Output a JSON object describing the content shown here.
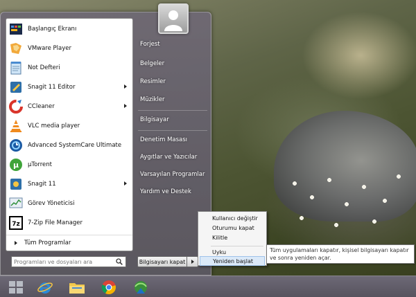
{
  "start_menu": {
    "programs": [
      {
        "label": "Başlangıç Ekranı",
        "icon": "start-screen-icon",
        "has_submenu": false
      },
      {
        "label": "VMware Player",
        "icon": "vmware-icon",
        "has_submenu": false
      },
      {
        "label": "Not Defteri",
        "icon": "notepad-icon",
        "has_submenu": false
      },
      {
        "label": "Snagit 11 Editor",
        "icon": "snagit-editor-icon",
        "has_submenu": true
      },
      {
        "label": "CCleaner",
        "icon": "ccleaner-icon",
        "has_submenu": true
      },
      {
        "label": "VLC media player",
        "icon": "vlc-icon",
        "has_submenu": false
      },
      {
        "label": "Advanced SystemCare Ultimate",
        "icon": "systemcare-icon",
        "has_submenu": false
      },
      {
        "label": "µTorrent",
        "icon": "utorrent-icon",
        "has_submenu": false
      },
      {
        "label": "Snagit 11",
        "icon": "snagit-icon",
        "has_submenu": true
      },
      {
        "label": "Görev Yöneticisi",
        "icon": "task-manager-icon",
        "has_submenu": false
      },
      {
        "label": "7-Zip File Manager",
        "icon": "7zip-icon",
        "has_submenu": false
      }
    ],
    "all_programs_label": "Tüm Programlar",
    "search_placeholder": "Programları ve dosyaları ara",
    "right_items": [
      "Forjest",
      "Belgeler",
      "Resimler",
      "Müzikler",
      "Bilgisayar",
      "Denetim Masası",
      "Aygıtlar ve Yazıcılar",
      "Varsayılan Programlar",
      "Yardım ve Destek"
    ],
    "shutdown_label": "Bilgisayarı kapat"
  },
  "shutdown_submenu": {
    "items": [
      "Kullanıcı değiştir",
      "Oturumu kapat",
      "Kilitle",
      "Uyku",
      "Yeniden başlat"
    ],
    "highlighted": "Yeniden başlat"
  },
  "tooltip": {
    "text": "Tüm uygulamaları kapatır, kişisel bilgisayarı kapatır ve sonra yeniden açar."
  },
  "taskbar": {
    "items": [
      "start-orb-icon",
      "internet-explorer-icon",
      "file-explorer-icon",
      "chrome-icon",
      "network-icon"
    ]
  },
  "colors": {
    "menu_frame": "#6e6874",
    "taskbar": "#5f5b66",
    "highlight": "#dbe9f8"
  }
}
